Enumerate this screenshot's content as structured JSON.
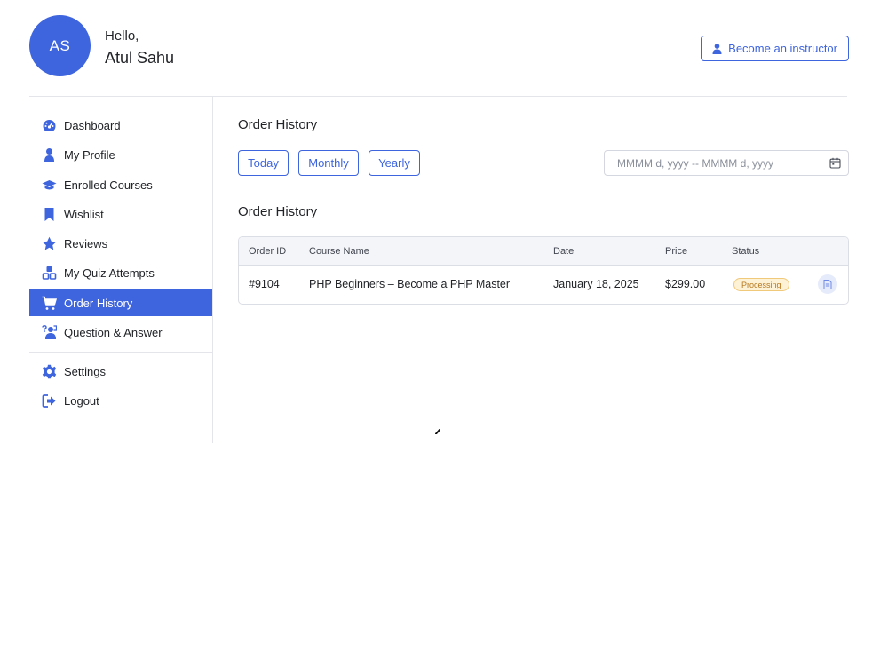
{
  "user": {
    "initials": "AS",
    "greeting": "Hello,",
    "name": "Atul Sahu"
  },
  "header": {
    "become_instructor_label": "Become an instructor"
  },
  "sidebar": {
    "items": [
      {
        "label": "Dashboard",
        "icon": "dashboard-icon"
      },
      {
        "label": "My Profile",
        "icon": "user-icon"
      },
      {
        "label": "Enrolled Courses",
        "icon": "graduation-cap-icon"
      },
      {
        "label": "Wishlist",
        "icon": "bookmark-icon"
      },
      {
        "label": "Reviews",
        "icon": "star-icon"
      },
      {
        "label": "My Quiz Attempts",
        "icon": "quiz-icon"
      },
      {
        "label": "Order History",
        "icon": "cart-icon",
        "active": true
      },
      {
        "label": "Question & Answer",
        "icon": "question-answer-icon"
      },
      {
        "label": "Settings",
        "icon": "gear-icon"
      },
      {
        "label": "Logout",
        "icon": "logout-icon"
      }
    ]
  },
  "main": {
    "title": "Order History",
    "filters": [
      "Today",
      "Monthly",
      "Yearly"
    ],
    "date_range_placeholder": "MMMM d, yyyy -- MMMM d, yyyy",
    "table_title": "Order History",
    "columns": [
      "Order ID",
      "Course Name",
      "Date",
      "Price",
      "Status"
    ],
    "rows": [
      {
        "order_id": "#9104",
        "course": "PHP Beginners – Become a PHP Master",
        "date": "January 18, 2025",
        "price": "$299.00",
        "status": "Processing"
      }
    ]
  },
  "colors": {
    "accent": "#3e64de",
    "badge_bg": "#fdf1d6",
    "badge_text": "#b7791f"
  }
}
